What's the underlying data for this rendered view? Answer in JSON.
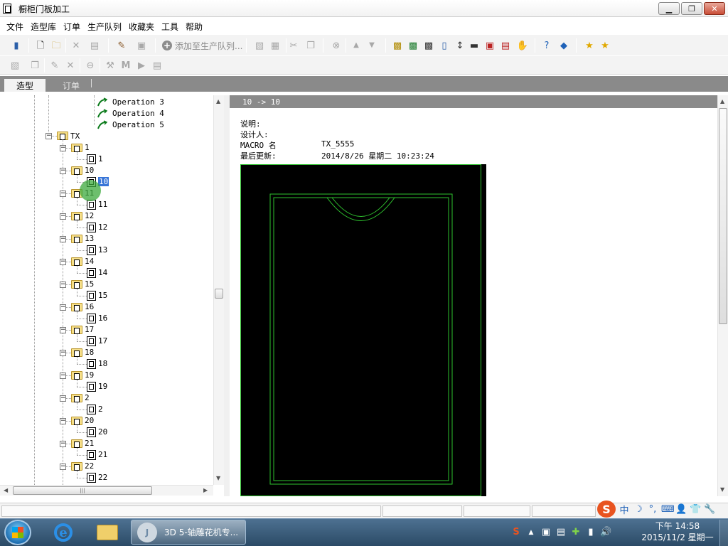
{
  "window": {
    "title": "橱柜门板加工",
    "min_glyph": "▁",
    "max_glyph": "❐",
    "close_glyph": "✕"
  },
  "menu": [
    "文件",
    "造型库",
    "订单",
    "生产队列",
    "收藏夹",
    "工具",
    "帮助"
  ],
  "toolbar": {
    "add_to_queue_label": "添加至生产队列...",
    "add_to_queue_glyph": "+"
  },
  "tabs": {
    "model": "造型",
    "order": "订单"
  },
  "tree": {
    "operations": [
      "Operation 3",
      "Operation 4",
      "Operation 5"
    ],
    "root": {
      "label": "TX",
      "expander": "−"
    },
    "groups": [
      {
        "label": "1",
        "child": "1"
      },
      {
        "label": "10",
        "child": "10",
        "selected": true
      },
      {
        "label": "11",
        "child": "11"
      },
      {
        "label": "12",
        "child": "12"
      },
      {
        "label": "13",
        "child": "13"
      },
      {
        "label": "14",
        "child": "14"
      },
      {
        "label": "15",
        "child": "15"
      },
      {
        "label": "16",
        "child": "16"
      },
      {
        "label": "17",
        "child": "17"
      },
      {
        "label": "18",
        "child": "18"
      },
      {
        "label": "19",
        "child": "19"
      },
      {
        "label": "2",
        "child": "2"
      },
      {
        "label": "20",
        "child": "20"
      },
      {
        "label": "21",
        "child": "21"
      },
      {
        "label": "22",
        "child": "22"
      }
    ]
  },
  "scroll": {
    "up": "▲",
    "down": "▼",
    "left": "◀",
    "right": "▶",
    "grip": "|||"
  },
  "detail": {
    "header": "10 -> 10",
    "fields": [
      {
        "label": "说明:",
        "value": ""
      },
      {
        "label": "设计人:",
        "value": ""
      },
      {
        "label": "MACRO 名",
        "value": "TX_5555"
      },
      {
        "label": "最后更新:",
        "value": "2014/8/26 星期二 10:23:24"
      }
    ]
  },
  "ime": {
    "logo": "S",
    "items": [
      "中",
      "☽",
      "°,",
      "⌨",
      "👤",
      "👕",
      "🔧"
    ]
  },
  "taskbar": {
    "app_label": "3D 5-轴雕花机专...",
    "app_icon_text": "J",
    "ie_text": "e",
    "tray_icons": [
      "S",
      "▲",
      "▣",
      "▤",
      "✚",
      "▮",
      "🔊"
    ],
    "clock_time": "下午 14:58",
    "clock_date": "2015/11/2 星期一"
  },
  "colors": {
    "tab_bar": "#8a8a8a",
    "preview_bg": "#000000",
    "outline": "#2ec22e",
    "selection": "#3875d7"
  }
}
